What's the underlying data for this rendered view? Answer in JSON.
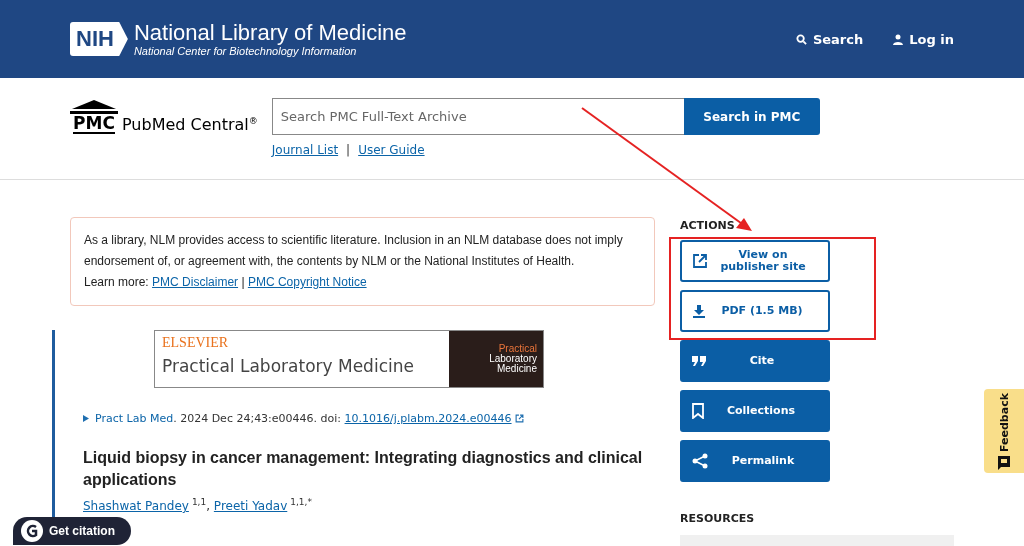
{
  "header": {
    "logo_mark": "NIH",
    "title": "National Library of Medicine",
    "subtitle": "National Center for Biotechnology Information",
    "nav": [
      {
        "kind": "search",
        "label": "Search"
      },
      {
        "kind": "login",
        "label": "Log in"
      }
    ]
  },
  "pmc": {
    "logo_mark": "PMC",
    "logo_text": "PubMed Central",
    "logo_reg": "®",
    "search_placeholder": "Search PMC Full-Text Archive",
    "search_button": "Search in PMC",
    "links": [
      "Journal List",
      "User Guide"
    ],
    "separator": "|"
  },
  "notice": {
    "text": "As a library, NLM provides access to scientific literature. Inclusion in an NLM database does not imply endorsement of, or agreement with, the contents by NLM or the National Institutes of Health.",
    "learn_more": "Learn more:",
    "links": [
      "PMC Disclaimer",
      "PMC Copyright Notice"
    ],
    "separator": "|"
  },
  "journal_banner": {
    "publisher": "ELSEVIER",
    "journal": "Practical Laboratory Medicine",
    "cover_lines": [
      "Practical",
      "Laboratory",
      "Medicine"
    ]
  },
  "citation": {
    "journal": "Pract Lab Med",
    "details": ". 2024 Dec 24;43:e00446. doi: ",
    "doi": "10.1016/j.plabm.2024.e00446"
  },
  "article": {
    "title": "Liquid biopsy in cancer management: Integrating diagnostics and clinical applications",
    "author_separator": ",",
    "authors": [
      {
        "name": "Shashwat Pandey",
        "sup": "1,1"
      },
      {
        "name": "Preeti Yadav",
        "sup": "1,1,*"
      }
    ]
  },
  "actions": {
    "heading": "ACTIONS",
    "buttons": [
      {
        "kind": "external",
        "label": "View on publisher site"
      },
      {
        "kind": "download",
        "label": "PDF (1.5 MB)"
      },
      {
        "kind": "quote",
        "label": "Cite"
      },
      {
        "kind": "bookmark",
        "label": "Collections"
      },
      {
        "kind": "share",
        "label": "Permalink"
      }
    ]
  },
  "resources": {
    "heading": "RESOURCES"
  },
  "get_citation": {
    "label": "Get citation"
  },
  "feedback": {
    "label": "Feedback"
  }
}
